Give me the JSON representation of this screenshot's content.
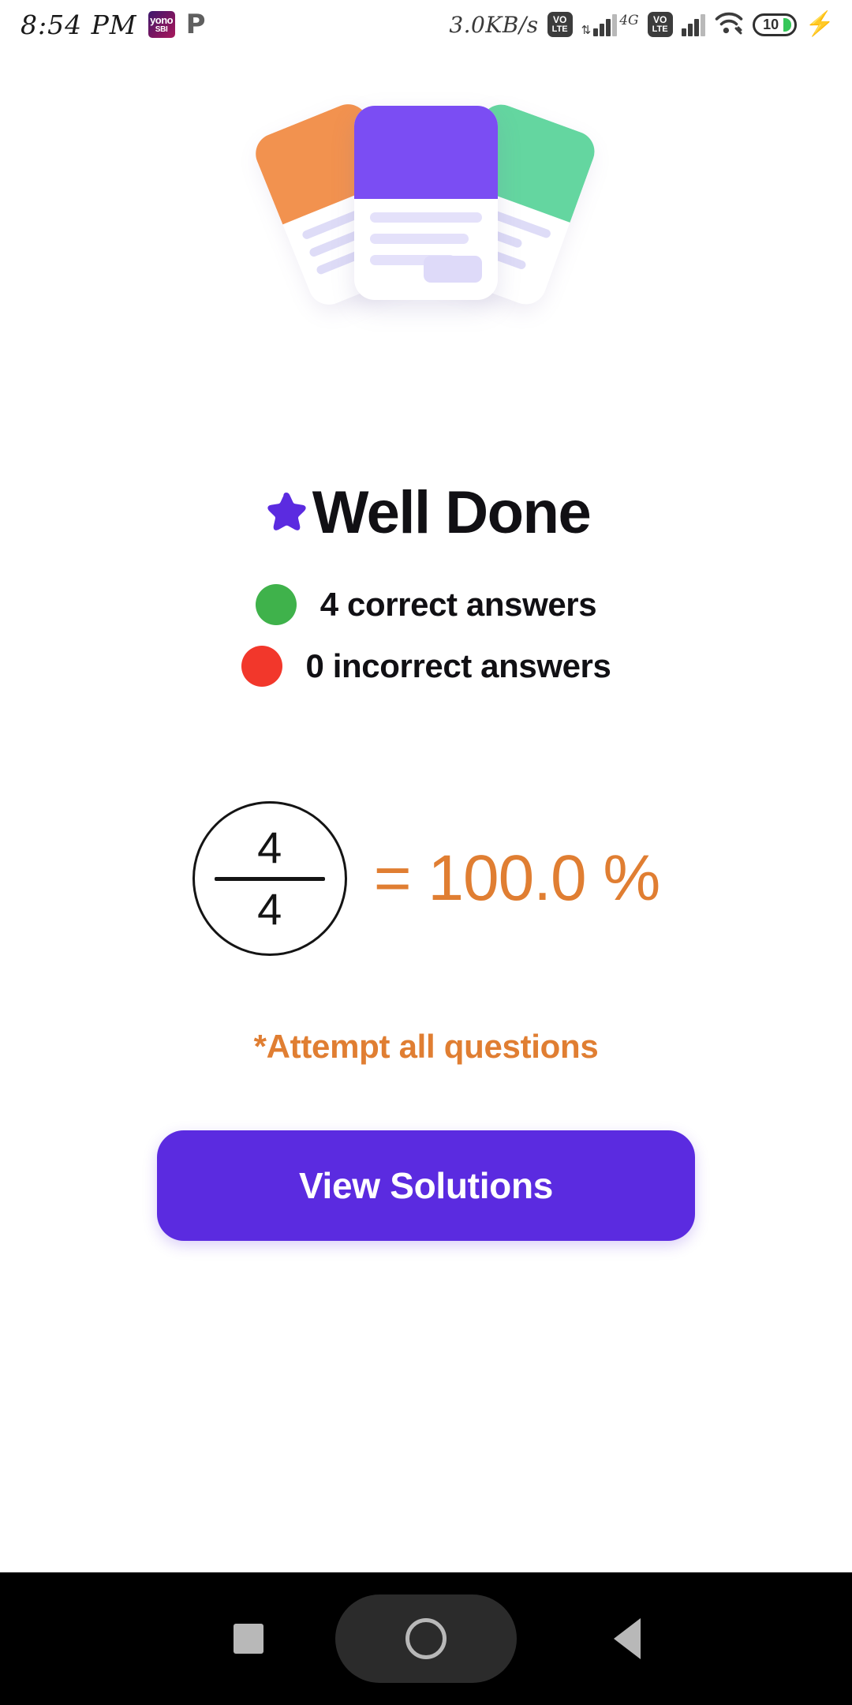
{
  "status_bar": {
    "time": "8:54 PM",
    "network_speed": "3.0KB/s",
    "app_icons": [
      {
        "name": "yono-sbi-icon",
        "line1": "yono",
        "line2": "SBI"
      },
      {
        "name": "phonepe-icon",
        "label": "P"
      }
    ],
    "volte_label_top": "VO",
    "volte_label_bottom": "LTE",
    "network_type": "4G",
    "battery_level": "10",
    "charging": true,
    "icons": [
      "volte-icon",
      "signal-bars-icon",
      "wifi-icon",
      "battery-icon",
      "charging-bolt-icon"
    ]
  },
  "illustration": {
    "name": "result-cards-illustration",
    "colors": {
      "card_left": "#F2924F",
      "card_center": "#7B4DF3",
      "card_right": "#64D6A0",
      "line": "#DEDCF7"
    }
  },
  "heading": {
    "star_icon": "star-icon",
    "title": "Well Done",
    "star_color": "#5B2BE0"
  },
  "stats": [
    {
      "label": "4 correct answers",
      "dot": "green-dot-icon",
      "color": "#3FB24B"
    },
    {
      "label": "0 incorrect answers",
      "dot": "red-dot-icon",
      "color": "#F2372B"
    }
  ],
  "score": {
    "numerator": "4",
    "denominator": "4",
    "equals_percent": "= 100.0 %",
    "accent_color": "#E07E32"
  },
  "note": {
    "text": "*Attempt all questions"
  },
  "cta": {
    "label": "View Solutions",
    "color": "#5B2BE0"
  },
  "nav_bar": {
    "items": [
      "recents-square-icon",
      "home-circle-icon",
      "back-triangle-icon"
    ]
  }
}
